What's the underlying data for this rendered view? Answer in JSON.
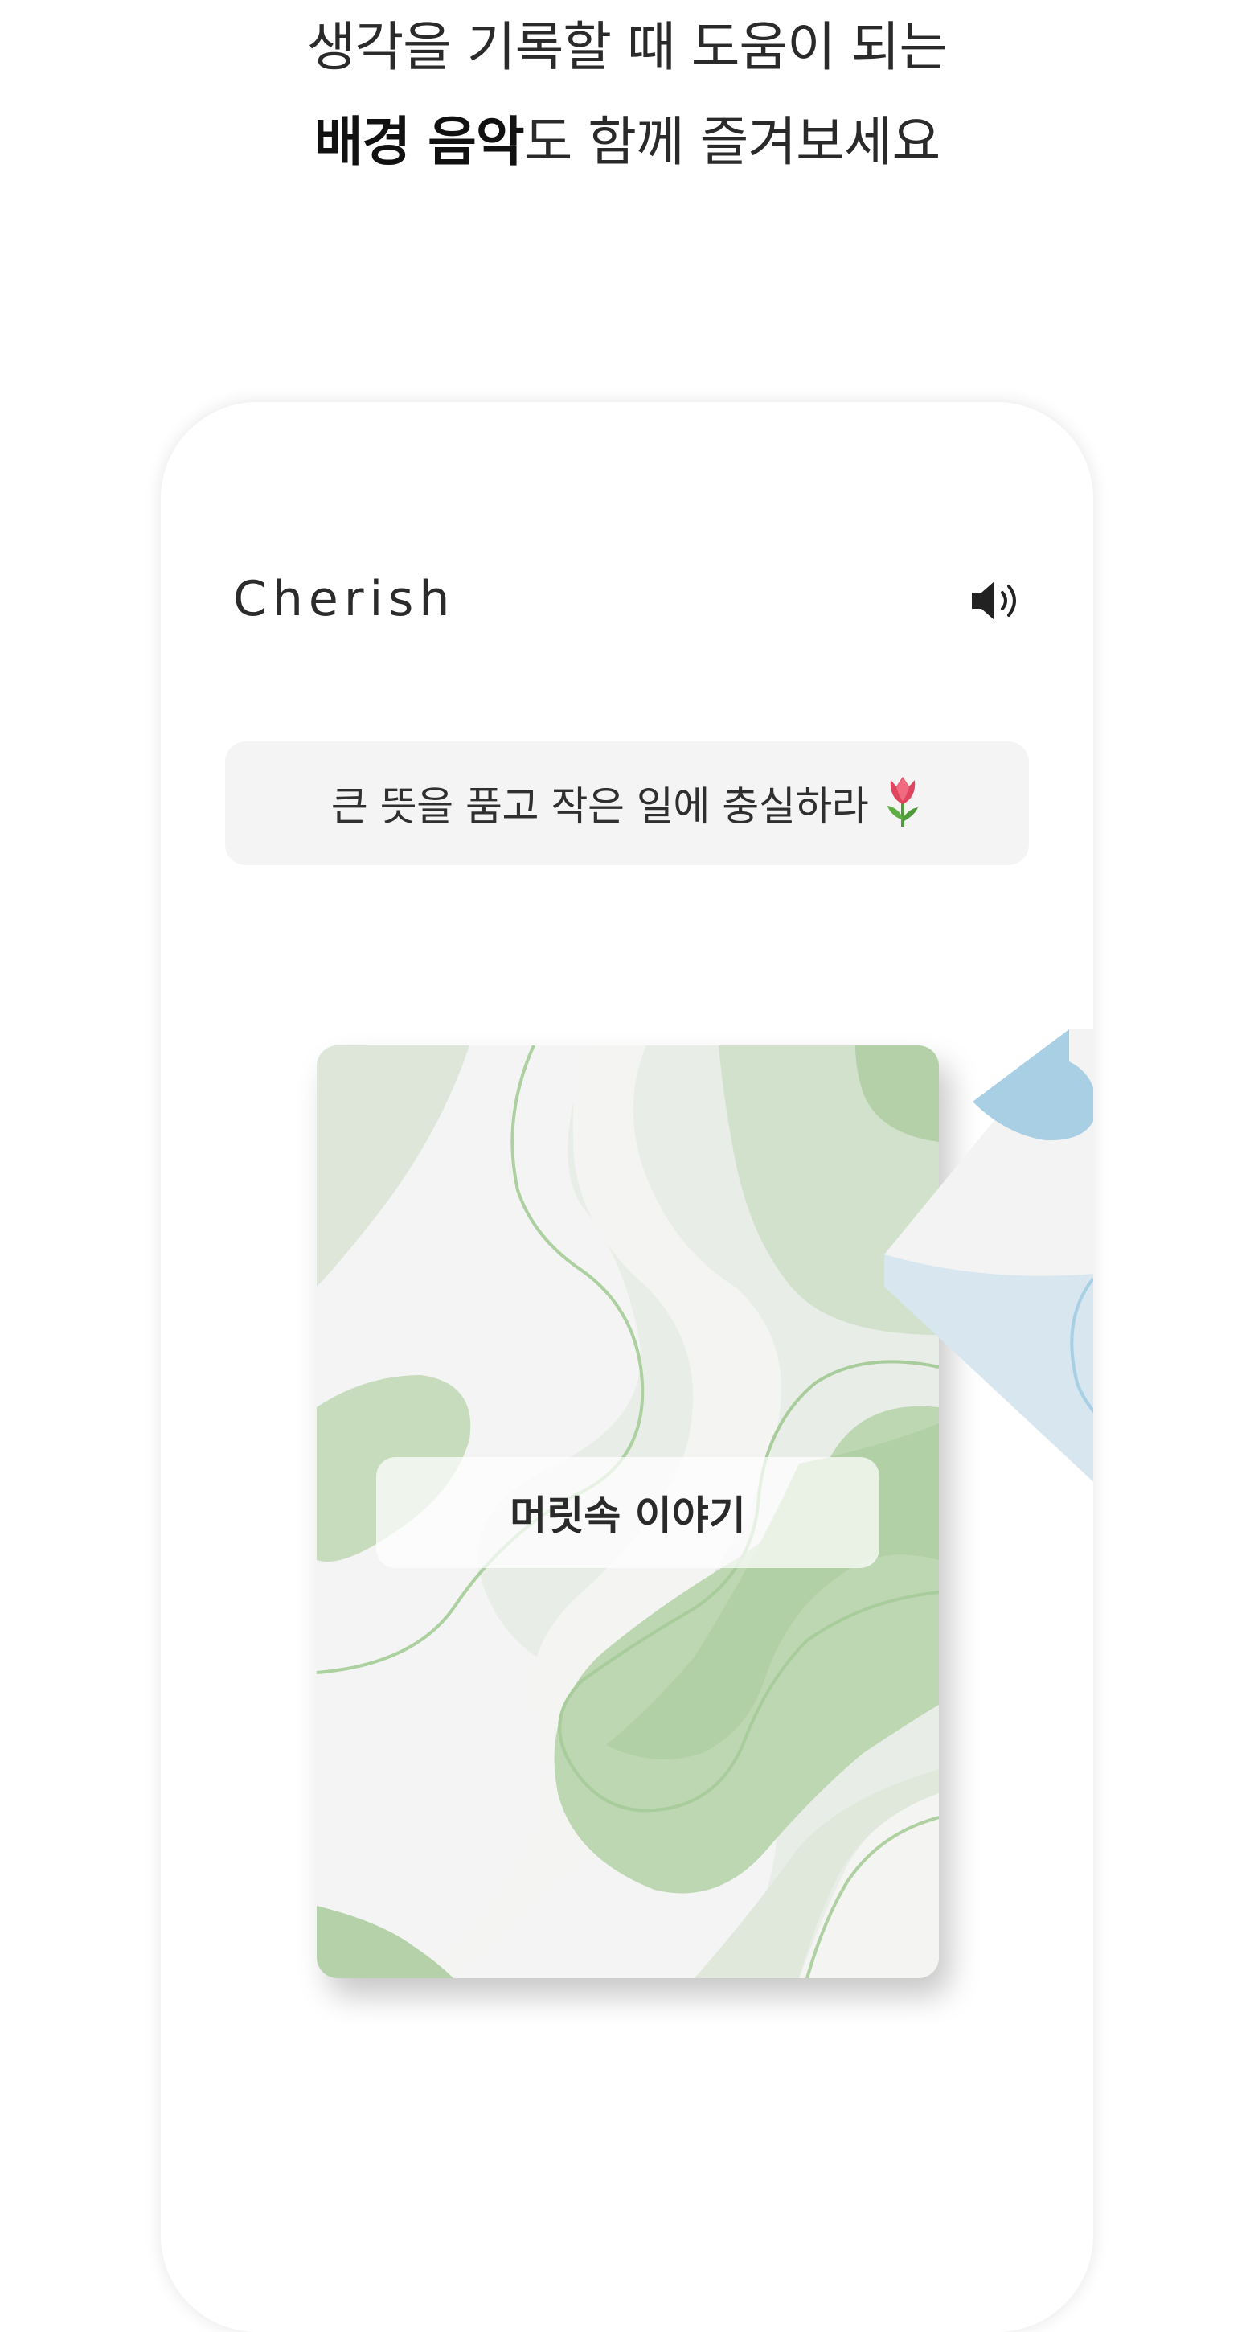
{
  "headline": {
    "line1": "생각을 기록할 때 도움이 되는",
    "line2_bold": "배경 음악",
    "line2_rest": "도 함께 즐겨보세요"
  },
  "app": {
    "title": "Cherish",
    "sound_icon": "speaker-volume-icon"
  },
  "quote": {
    "text": "큰 뜻을 품고 작은 일에 충실하라",
    "emoji_icon": "tulip-icon"
  },
  "card": {
    "label": "머릿속 이야기",
    "palette": {
      "light": "#f4f4f4",
      "pale": "#e8eee6",
      "mid": "#d4e2cf",
      "green": "#bdd7b5",
      "deep": "#aecda3",
      "line": "#a9cc9c"
    }
  },
  "next_card": {
    "palette": {
      "light": "#f3f3f3",
      "blue": "#d8e6ef",
      "deep_blue": "#a9cfe4"
    }
  }
}
